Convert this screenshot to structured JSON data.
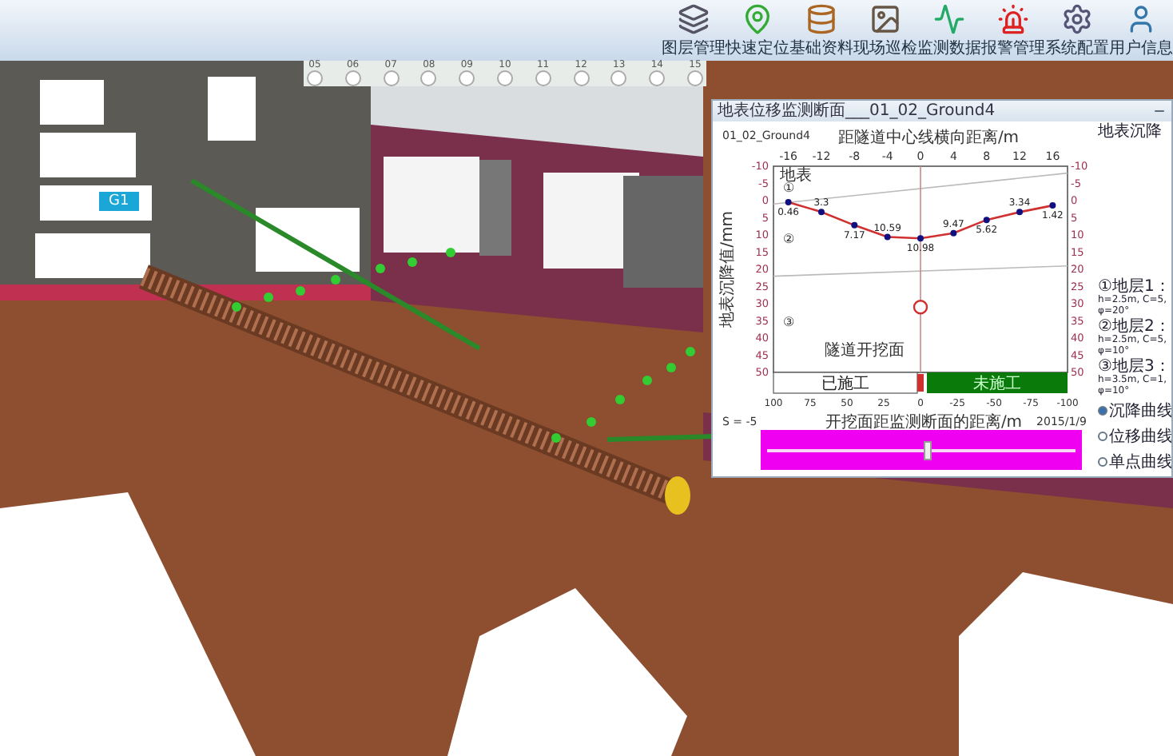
{
  "toolbar": [
    {
      "label": "图层管理"
    },
    {
      "label": "快速定位"
    },
    {
      "label": "基础资料"
    },
    {
      "label": "现场巡检"
    },
    {
      "label": "监测数据"
    },
    {
      "label": "报警管理"
    },
    {
      "label": "系统配置"
    },
    {
      "label": "用户信息"
    }
  ],
  "timeline": {
    "labels": [
      "05",
      "06",
      "07",
      "08",
      "09",
      "10",
      "11",
      "12",
      "13",
      "14",
      "15"
    ]
  },
  "scene": {
    "label": "G1"
  },
  "monitor_window": {
    "title": "地表位移监测断面___01_02_Ground4",
    "chart_data": {
      "type": "line",
      "title": "01_02_Ground4",
      "xlabel": "距隧道中心线横向距离/m",
      "ylabel": "地表沉降值/mm",
      "x": [
        -16,
        -12,
        -8,
        -4,
        0,
        4,
        8,
        12,
        16
      ],
      "series": [
        {
          "name": "地表沉降",
          "color": "#d03030",
          "marker": "circle",
          "values": [
            0.46,
            3.3,
            7.17,
            10.59,
            10.98,
            9.47,
            5.62,
            3.34,
            1.42
          ]
        }
      ],
      "xlim": [
        -17.8,
        17.8
      ],
      "ylim": [
        50,
        -10
      ],
      "xticks": [
        -16,
        -12,
        -8,
        -4,
        0,
        4,
        8,
        12,
        16
      ],
      "yticks": [
        -10,
        -5,
        0,
        5,
        10,
        15,
        20,
        25,
        30,
        35,
        40,
        45,
        50
      ],
      "data_labels": true,
      "ref_lines": [
        {
          "axis": "x",
          "value": 0,
          "color": "#cc8888"
        }
      ]
    },
    "surface_label": "地表",
    "stratum_markers": [
      "①",
      "②",
      "③"
    ],
    "face_label": "隧道开挖面",
    "progress": {
      "done_label": "已施工",
      "remaining_label": "未施工",
      "xticks": [
        "100",
        "75",
        "50",
        "25",
        "0",
        "-25",
        "-50",
        "-75",
        "-100"
      ],
      "xlabel": "开挖面距监测断面的距离/m"
    },
    "left_axis_ticks": [
      "-10",
      "-5",
      "0",
      "5",
      "10",
      "15",
      "20",
      "25",
      "30",
      "35",
      "40",
      "45",
      "50"
    ],
    "right_axis_ticks": [
      "-10",
      "-5",
      "0",
      "5",
      "10",
      "15",
      "20",
      "25",
      "30",
      "35",
      "40",
      "45",
      "50"
    ],
    "s_value": "S = -5",
    "date": "2015/1/9",
    "strata": [
      [
        "①地层1：",
        "h=2.5m, C=5,",
        "φ=20°"
      ],
      [
        "②地层2：",
        "h=2.5m, C=5,",
        "φ=10°"
      ],
      [
        "③地层3：",
        "h=3.5m, C=1,",
        "φ=10°"
      ]
    ],
    "options": [
      {
        "label": "沉降曲线",
        "selected": true
      },
      {
        "label": "位移曲线",
        "selected": false
      },
      {
        "label": "单点曲线",
        "selected": false
      }
    ],
    "slider": {
      "level": 0.52
    }
  }
}
